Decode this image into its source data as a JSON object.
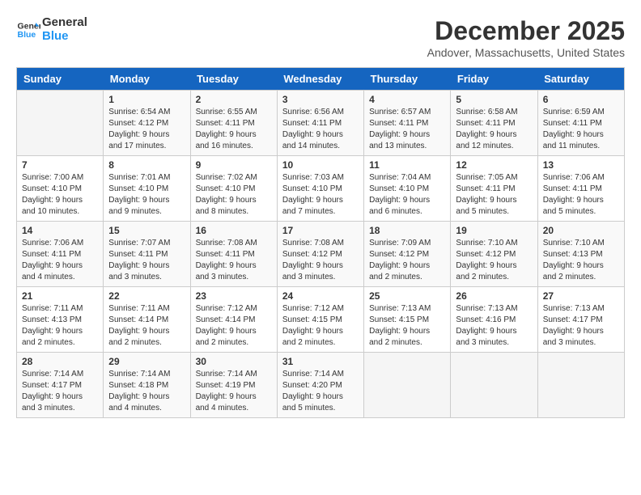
{
  "header": {
    "logo_line1": "General",
    "logo_line2": "Blue",
    "month_year": "December 2025",
    "location": "Andover, Massachusetts, United States"
  },
  "weekdays": [
    "Sunday",
    "Monday",
    "Tuesday",
    "Wednesday",
    "Thursday",
    "Friday",
    "Saturday"
  ],
  "weeks": [
    [
      {
        "day": "",
        "sunrise": "",
        "sunset": "",
        "daylight": ""
      },
      {
        "day": "1",
        "sunrise": "Sunrise: 6:54 AM",
        "sunset": "Sunset: 4:12 PM",
        "daylight": "Daylight: 9 hours and 17 minutes."
      },
      {
        "day": "2",
        "sunrise": "Sunrise: 6:55 AM",
        "sunset": "Sunset: 4:11 PM",
        "daylight": "Daylight: 9 hours and 16 minutes."
      },
      {
        "day": "3",
        "sunrise": "Sunrise: 6:56 AM",
        "sunset": "Sunset: 4:11 PM",
        "daylight": "Daylight: 9 hours and 14 minutes."
      },
      {
        "day": "4",
        "sunrise": "Sunrise: 6:57 AM",
        "sunset": "Sunset: 4:11 PM",
        "daylight": "Daylight: 9 hours and 13 minutes."
      },
      {
        "day": "5",
        "sunrise": "Sunrise: 6:58 AM",
        "sunset": "Sunset: 4:11 PM",
        "daylight": "Daylight: 9 hours and 12 minutes."
      },
      {
        "day": "6",
        "sunrise": "Sunrise: 6:59 AM",
        "sunset": "Sunset: 4:11 PM",
        "daylight": "Daylight: 9 hours and 11 minutes."
      }
    ],
    [
      {
        "day": "7",
        "sunrise": "Sunrise: 7:00 AM",
        "sunset": "Sunset: 4:10 PM",
        "daylight": "Daylight: 9 hours and 10 minutes."
      },
      {
        "day": "8",
        "sunrise": "Sunrise: 7:01 AM",
        "sunset": "Sunset: 4:10 PM",
        "daylight": "Daylight: 9 hours and 9 minutes."
      },
      {
        "day": "9",
        "sunrise": "Sunrise: 7:02 AM",
        "sunset": "Sunset: 4:10 PM",
        "daylight": "Daylight: 9 hours and 8 minutes."
      },
      {
        "day": "10",
        "sunrise": "Sunrise: 7:03 AM",
        "sunset": "Sunset: 4:10 PM",
        "daylight": "Daylight: 9 hours and 7 minutes."
      },
      {
        "day": "11",
        "sunrise": "Sunrise: 7:04 AM",
        "sunset": "Sunset: 4:10 PM",
        "daylight": "Daylight: 9 hours and 6 minutes."
      },
      {
        "day": "12",
        "sunrise": "Sunrise: 7:05 AM",
        "sunset": "Sunset: 4:11 PM",
        "daylight": "Daylight: 9 hours and 5 minutes."
      },
      {
        "day": "13",
        "sunrise": "Sunrise: 7:06 AM",
        "sunset": "Sunset: 4:11 PM",
        "daylight": "Daylight: 9 hours and 5 minutes."
      }
    ],
    [
      {
        "day": "14",
        "sunrise": "Sunrise: 7:06 AM",
        "sunset": "Sunset: 4:11 PM",
        "daylight": "Daylight: 9 hours and 4 minutes."
      },
      {
        "day": "15",
        "sunrise": "Sunrise: 7:07 AM",
        "sunset": "Sunset: 4:11 PM",
        "daylight": "Daylight: 9 hours and 3 minutes."
      },
      {
        "day": "16",
        "sunrise": "Sunrise: 7:08 AM",
        "sunset": "Sunset: 4:11 PM",
        "daylight": "Daylight: 9 hours and 3 minutes."
      },
      {
        "day": "17",
        "sunrise": "Sunrise: 7:08 AM",
        "sunset": "Sunset: 4:12 PM",
        "daylight": "Daylight: 9 hours and 3 minutes."
      },
      {
        "day": "18",
        "sunrise": "Sunrise: 7:09 AM",
        "sunset": "Sunset: 4:12 PM",
        "daylight": "Daylight: 9 hours and 2 minutes."
      },
      {
        "day": "19",
        "sunrise": "Sunrise: 7:10 AM",
        "sunset": "Sunset: 4:12 PM",
        "daylight": "Daylight: 9 hours and 2 minutes."
      },
      {
        "day": "20",
        "sunrise": "Sunrise: 7:10 AM",
        "sunset": "Sunset: 4:13 PM",
        "daylight": "Daylight: 9 hours and 2 minutes."
      }
    ],
    [
      {
        "day": "21",
        "sunrise": "Sunrise: 7:11 AM",
        "sunset": "Sunset: 4:13 PM",
        "daylight": "Daylight: 9 hours and 2 minutes."
      },
      {
        "day": "22",
        "sunrise": "Sunrise: 7:11 AM",
        "sunset": "Sunset: 4:14 PM",
        "daylight": "Daylight: 9 hours and 2 minutes."
      },
      {
        "day": "23",
        "sunrise": "Sunrise: 7:12 AM",
        "sunset": "Sunset: 4:14 PM",
        "daylight": "Daylight: 9 hours and 2 minutes."
      },
      {
        "day": "24",
        "sunrise": "Sunrise: 7:12 AM",
        "sunset": "Sunset: 4:15 PM",
        "daylight": "Daylight: 9 hours and 2 minutes."
      },
      {
        "day": "25",
        "sunrise": "Sunrise: 7:13 AM",
        "sunset": "Sunset: 4:15 PM",
        "daylight": "Daylight: 9 hours and 2 minutes."
      },
      {
        "day": "26",
        "sunrise": "Sunrise: 7:13 AM",
        "sunset": "Sunset: 4:16 PM",
        "daylight": "Daylight: 9 hours and 3 minutes."
      },
      {
        "day": "27",
        "sunrise": "Sunrise: 7:13 AM",
        "sunset": "Sunset: 4:17 PM",
        "daylight": "Daylight: 9 hours and 3 minutes."
      }
    ],
    [
      {
        "day": "28",
        "sunrise": "Sunrise: 7:14 AM",
        "sunset": "Sunset: 4:17 PM",
        "daylight": "Daylight: 9 hours and 3 minutes."
      },
      {
        "day": "29",
        "sunrise": "Sunrise: 7:14 AM",
        "sunset": "Sunset: 4:18 PM",
        "daylight": "Daylight: 9 hours and 4 minutes."
      },
      {
        "day": "30",
        "sunrise": "Sunrise: 7:14 AM",
        "sunset": "Sunset: 4:19 PM",
        "daylight": "Daylight: 9 hours and 4 minutes."
      },
      {
        "day": "31",
        "sunrise": "Sunrise: 7:14 AM",
        "sunset": "Sunset: 4:20 PM",
        "daylight": "Daylight: 9 hours and 5 minutes."
      },
      {
        "day": "",
        "sunrise": "",
        "sunset": "",
        "daylight": ""
      },
      {
        "day": "",
        "sunrise": "",
        "sunset": "",
        "daylight": ""
      },
      {
        "day": "",
        "sunrise": "",
        "sunset": "",
        "daylight": ""
      }
    ]
  ]
}
